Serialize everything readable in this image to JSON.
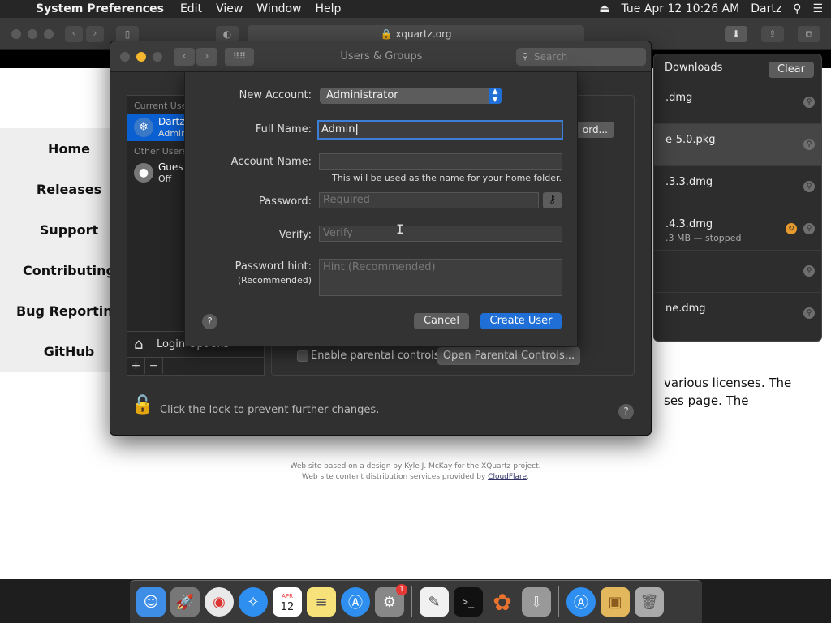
{
  "menubar": {
    "app_name": "System Preferences",
    "menus": [
      "Edit",
      "View",
      "Window",
      "Help"
    ],
    "datetime": "Tue Apr 12  10:26 AM",
    "user": "Dartz"
  },
  "safari": {
    "url": "xquartz.org"
  },
  "webpage": {
    "nav": [
      "Home",
      "Releases",
      "Support",
      "Contributing",
      "Bug Reporting",
      "GitHub"
    ],
    "body_line1": "various licenses. The",
    "body_link": "ses page",
    "body_line2_tail": ". The",
    "footer_line1": "Web site based on a design by Kyle J. McKay for the XQuartz project.",
    "footer_line2_prefix": "Web site content distribution services provided by ",
    "footer_link": "CloudFlare",
    "footer_line2_suffix": "."
  },
  "downloads": {
    "title": "Downloads",
    "clear_label": "Clear",
    "items": [
      {
        "name": ".dmg",
        "sub": ""
      },
      {
        "name": "e-5.0.pkg",
        "sub": ""
      },
      {
        "name": ".3.3.dmg",
        "sub": ""
      },
      {
        "name": ".4.3.dmg",
        "sub": ".3 MB — stopped"
      },
      {
        "name": "",
        "sub": ""
      },
      {
        "name": "ne.dmg",
        "sub": ""
      }
    ]
  },
  "prefs": {
    "title": "Users & Groups",
    "search_placeholder": "Search",
    "current_users_header": "Current Use",
    "other_users_header": "Other Users",
    "users": [
      {
        "name": "Dartz",
        "role": "Admin"
      },
      {
        "name": "Gues",
        "role": "Off"
      }
    ],
    "login_options": "Login Options",
    "change_pw_label": "ord...",
    "parental_label": "Enable parental controls",
    "parental_button": "Open Parental Controls...",
    "lock_text": "Click the lock to prevent further changes."
  },
  "sheet": {
    "new_account_label": "New Account:",
    "new_account_value": "Administrator",
    "full_name_label": "Full Name:",
    "full_name_value": "Admin",
    "account_name_label": "Account Name:",
    "account_name_value": "",
    "home_hint": "This will be used as the name for your home folder.",
    "password_label": "Password:",
    "password_placeholder": "Required",
    "verify_label": "Verify:",
    "verify_placeholder": "Verify",
    "hint_label": "Password hint:",
    "hint_label_sub": "(Recommended)",
    "hint_placeholder": "Hint (Recommended)",
    "cancel_label": "Cancel",
    "create_label": "Create User"
  },
  "dock": {
    "calendar_month": "APR",
    "calendar_day": "12",
    "prefs_badge": "1"
  }
}
